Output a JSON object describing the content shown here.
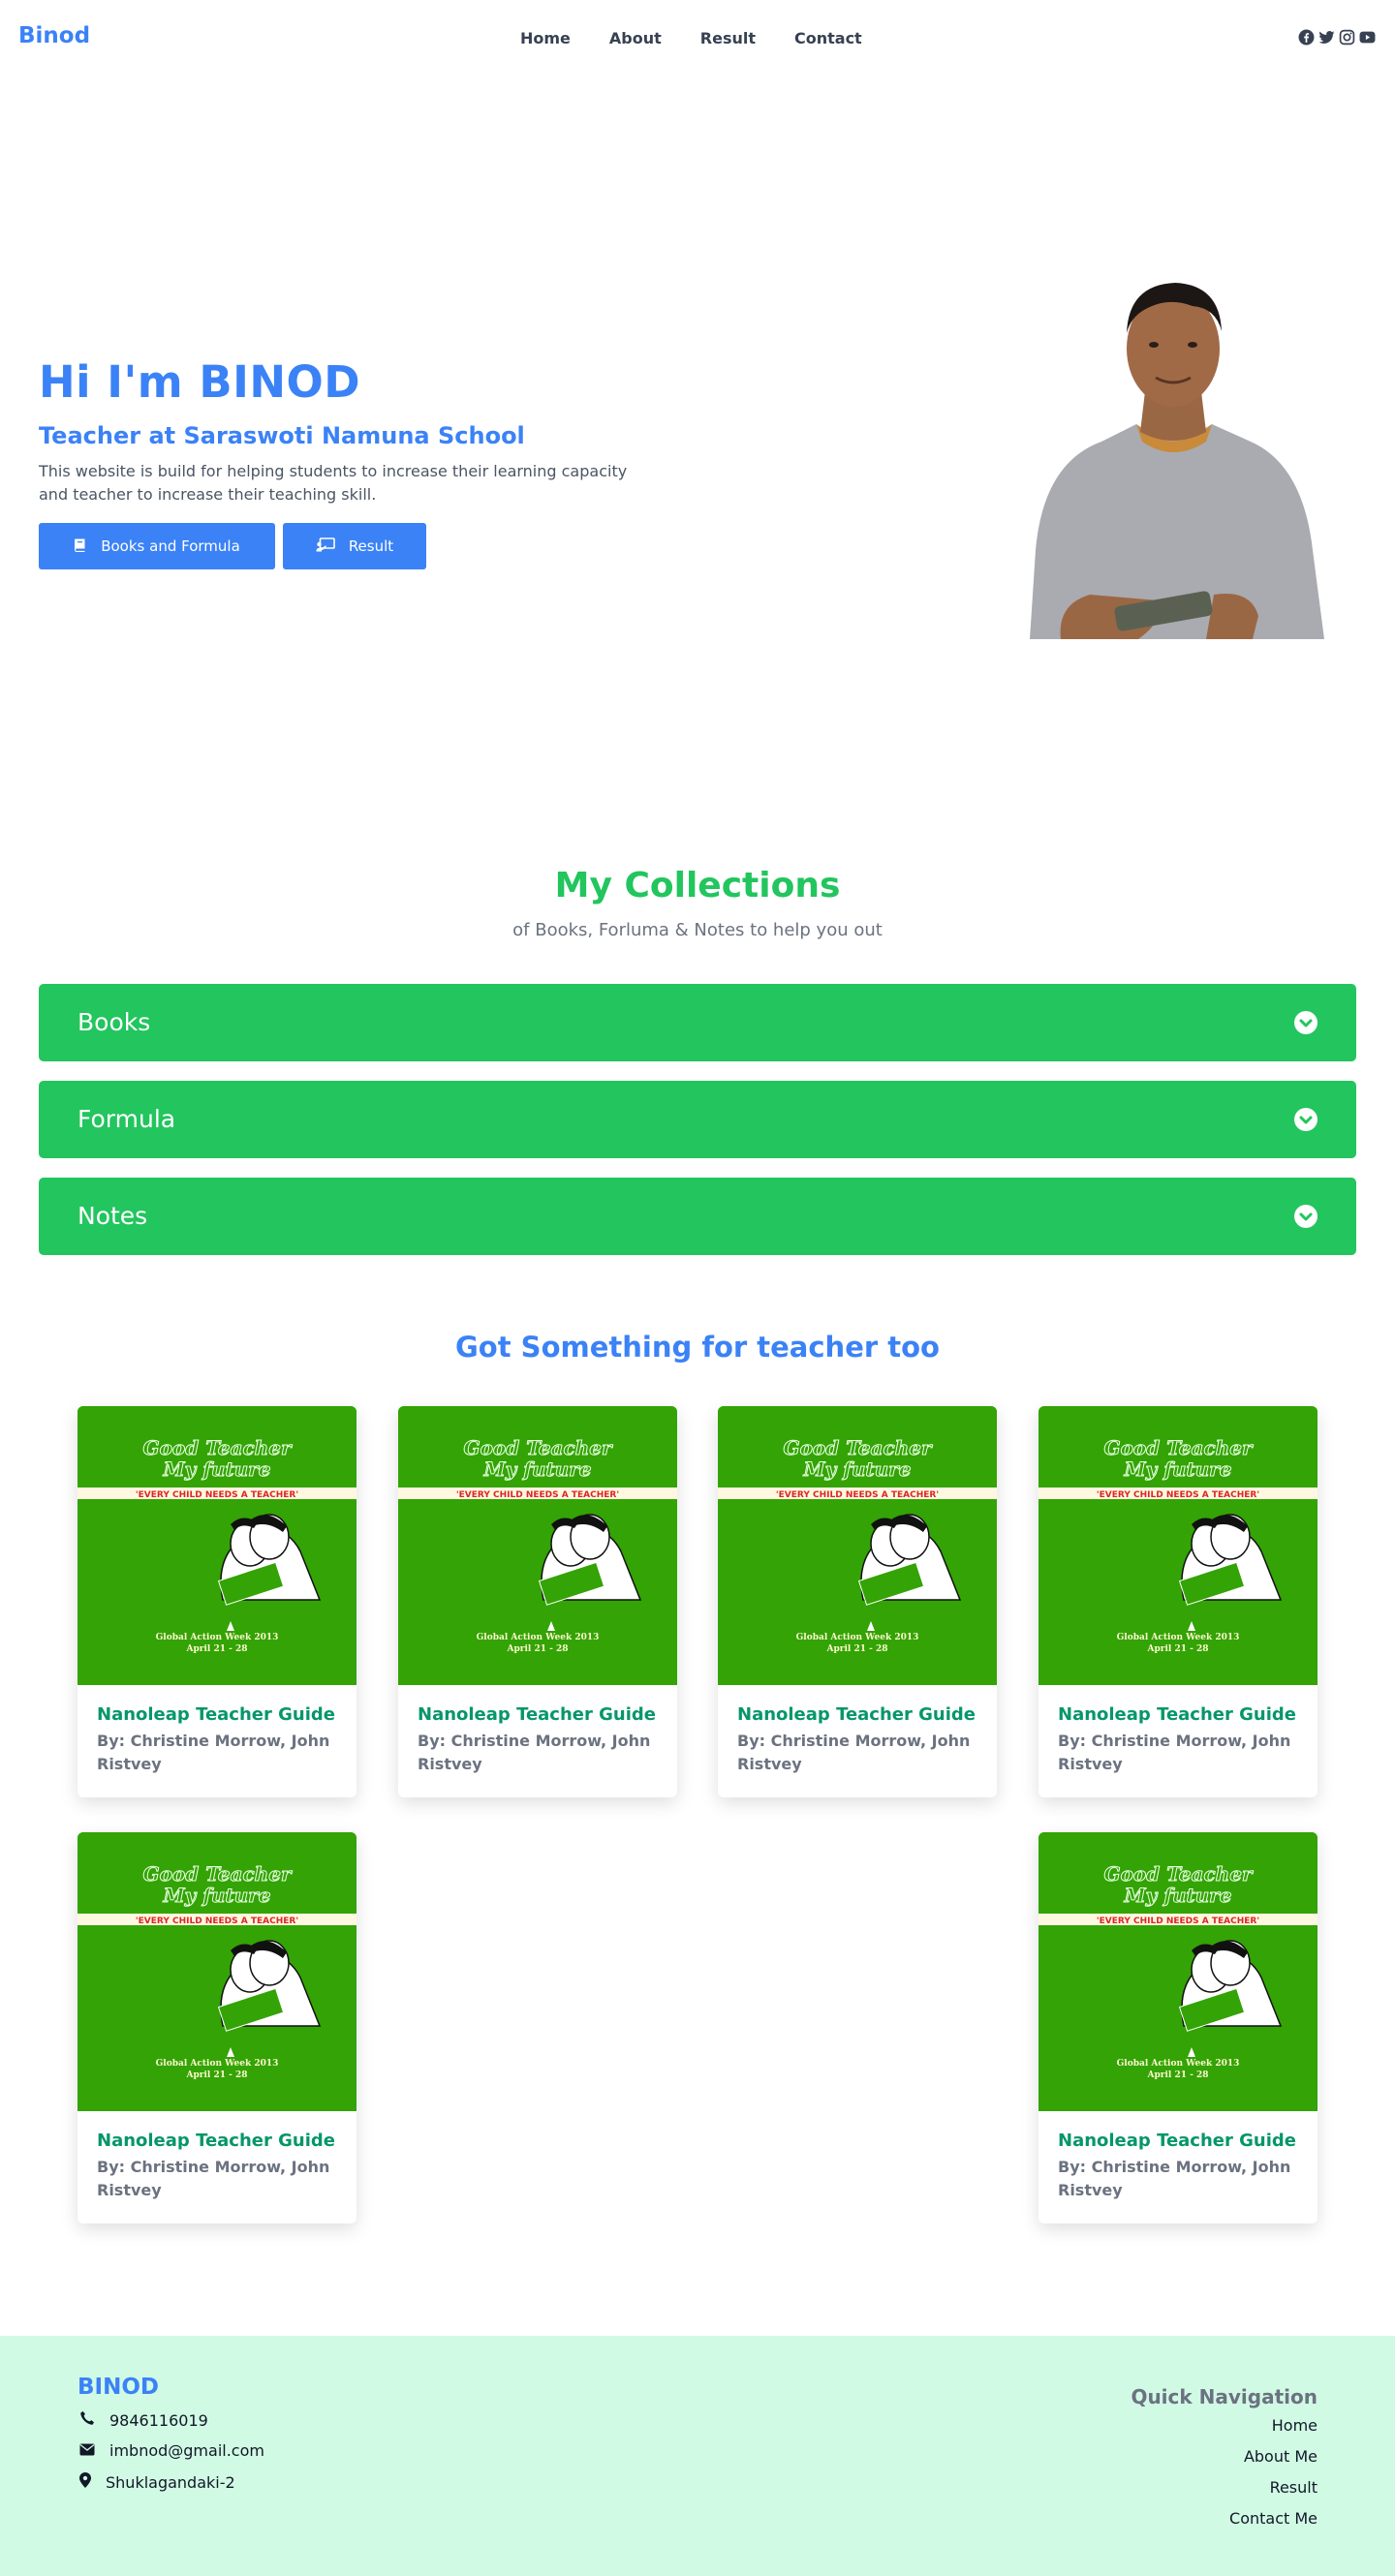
{
  "nav": {
    "brand": "Binod",
    "links": [
      "Home",
      "About",
      "Result",
      "Contact"
    ],
    "social_icons": [
      "facebook-icon",
      "twitter-icon",
      "instagram-icon",
      "youtube-icon"
    ]
  },
  "hero": {
    "title": "Hi I'm BINOD",
    "subtitle": "Teacher at Saraswoti Namuna School",
    "description": "This website is build for helping students to increase their learning capacity and teacher to increase their teaching skill.",
    "btn_books": "Books and Formula",
    "btn_result": "Result",
    "btn_books_icon": "book-icon",
    "btn_result_icon": "chalkboard-teacher-icon"
  },
  "collections": {
    "title": "My Collections",
    "subtitle": "of Books, Forluma & Notes to help you out",
    "items": [
      "Books",
      "Formula",
      "Notes"
    ]
  },
  "teacher": {
    "title": "Got Something for teacher too",
    "cover": {
      "line1": "Good Teacher",
      "line2": "My future",
      "banner": "'EVERY CHILD NEEDS A TEACHER'",
      "event": "Global Action Week 2013",
      "dates": "April 21 - 28"
    },
    "cards": [
      {
        "title": "Nanoleap Teacher Guide",
        "author": "By: Christine Morrow, John Ristvey"
      },
      {
        "title": "Nanoleap Teacher Guide",
        "author": "By: Christine Morrow, John Ristvey"
      },
      {
        "title": "Nanoleap Teacher Guide",
        "author": "By: Christine Morrow, John Ristvey"
      },
      {
        "title": "Nanoleap Teacher Guide",
        "author": "By: Christine Morrow, John Ristvey"
      },
      {
        "title": "Nanoleap Teacher Guide",
        "author": "By: Christine Morrow, John Ristvey"
      },
      {
        "title": "Nanoleap Teacher Guide",
        "author": "By: Christine Morrow, John Ristvey"
      }
    ]
  },
  "footer": {
    "brand": "BINOD",
    "phone": "9846116019",
    "email": "imbnod@gmail.com",
    "address": "Shuklagandaki-2",
    "nav_title": "Quick Navigation",
    "links": [
      "Home",
      "About Me",
      "Result",
      "Contact Me"
    ]
  },
  "colors": {
    "primary": "#3b82f6",
    "green": "#22c55e",
    "card_title": "#059669",
    "cover_green": "#33a305",
    "footer_bg": "#d1fae5"
  }
}
